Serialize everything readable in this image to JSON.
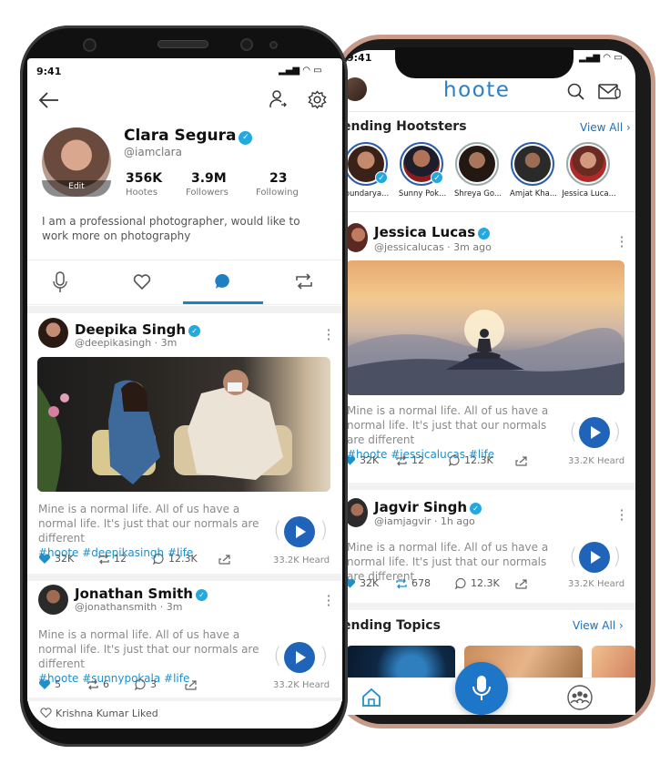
{
  "left_phone": {
    "status": {
      "time": "9:41"
    },
    "profile": {
      "name": "Clara Segura",
      "handle": "@iamclara",
      "edit_label": "Edit",
      "stats": [
        {
          "value": "356K",
          "label": "Hootes"
        },
        {
          "value": "3.9M",
          "label": "Followers"
        },
        {
          "value": "23",
          "label": "Following"
        }
      ],
      "bio": "I am a professional photographer, would like to work more on photography"
    },
    "tabs": [
      "mic-icon",
      "heart-icon",
      "chat-icon",
      "repost-icon"
    ],
    "active_tab": 2,
    "posts": [
      {
        "name": "Deepika Singh",
        "handle": "@deepikasingh · 3m",
        "text": "Mine is a normal life. All of us have a normal life. It's just that our normals are different",
        "tags": "#hoote #deepikasingh #life",
        "likes": "32K",
        "reposts": "12",
        "comments": "12.3K",
        "heard": "33.2K Heard"
      },
      {
        "name": "Jonathan Smith",
        "handle": "@jonathansmith · 3m",
        "text": "Mine is a normal life. All of us have a normal life. It's just that our normals are different",
        "tags": "#hoote #sunnypokala #life",
        "likes": "5",
        "reposts": "6",
        "comments": "3",
        "heard": "33.2K Heard"
      }
    ],
    "liked_notice": "Krishna Kumar Liked"
  },
  "right_phone": {
    "status": {
      "time": "9:41"
    },
    "logo": "hoote",
    "trending_hootsters": {
      "title": "ending Hootsters",
      "view_all": "View All",
      "people": [
        "oundarya...",
        "Sunny Pok...",
        "Shreya Go...",
        "Amjat Kha...",
        "Jessica Luca..."
      ]
    },
    "posts": [
      {
        "name": "Jessica Lucas",
        "handle": "@jessicalucas · 3m ago",
        "text": "Mine is a normal life. All of us have a normal life. It's just that our normals are different",
        "tags": "#hoote #jessicalucas #life",
        "likes": "32K",
        "reposts": "12",
        "comments": "12.3K",
        "heard": "33.2K Heard"
      },
      {
        "name": "Jagvir Singh",
        "handle": "@iamjagvir · 1h ago",
        "text": "Mine is a normal life. All of us have a normal life. It's just that our normals are different",
        "tags": "",
        "likes": "32K",
        "reposts": "678",
        "comments": "12.3K",
        "heard": "33.2K Heard"
      }
    ],
    "trending_topics": {
      "title": "ending Topics",
      "view_all": "View All"
    },
    "colors": {
      "brand": "#2c7fc4",
      "accent": "#23a8e0",
      "play": "#1f64b8"
    }
  }
}
